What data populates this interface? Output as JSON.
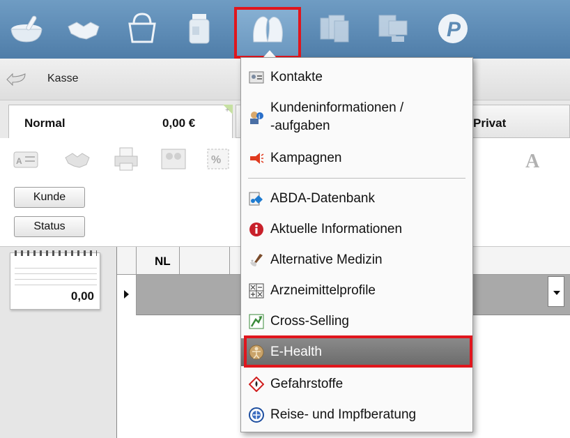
{
  "toolbar": {
    "icons": [
      "mortar-icon",
      "handshake-icon",
      "basket-icon",
      "medicine-jar-icon",
      "people-icon",
      "documents-icon",
      "workstation-icon",
      "p-logo-icon"
    ],
    "active": "people-icon"
  },
  "breadcrumb": {
    "label": "Kasse"
  },
  "tabs": {
    "normal": {
      "label": "Normal",
      "amount": "0,00 €"
    },
    "privat": {
      "label": "Privat"
    }
  },
  "buttons": {
    "kunde": "Kunde",
    "status": "Status"
  },
  "notepad": {
    "amount": "0,00"
  },
  "grid": {
    "columns": [
      "NL"
    ]
  },
  "menu": {
    "items": [
      {
        "label": "Kontakte",
        "icon": "contact-card-icon"
      },
      {
        "label": "Kundeninformationen /",
        "label2": "-aufgaben",
        "icon": "customer-info-icon"
      },
      {
        "label": "Kampagnen",
        "icon": "megaphone-icon"
      },
      {
        "label": "ABDA-Datenbank",
        "icon": "database-icon"
      },
      {
        "label": "Aktuelle Informationen",
        "icon": "info-icon"
      },
      {
        "label": "Alternative Medizin",
        "icon": "mortar-pestle-icon"
      },
      {
        "label": "Arzneimittelprofile",
        "icon": "profile-grid-icon"
      },
      {
        "label": "Cross-Selling",
        "icon": "cross-selling-icon"
      },
      {
        "label": "E-Health",
        "icon": "vitruvian-icon"
      },
      {
        "label": "Gefahrstoffe",
        "icon": "hazard-icon"
      },
      {
        "label": "Reise- und Impfberatung",
        "icon": "travel-vaccine-icon"
      }
    ]
  },
  "colors": {
    "highlight": "#e0161d",
    "toolbar": "#5d8bb5"
  }
}
